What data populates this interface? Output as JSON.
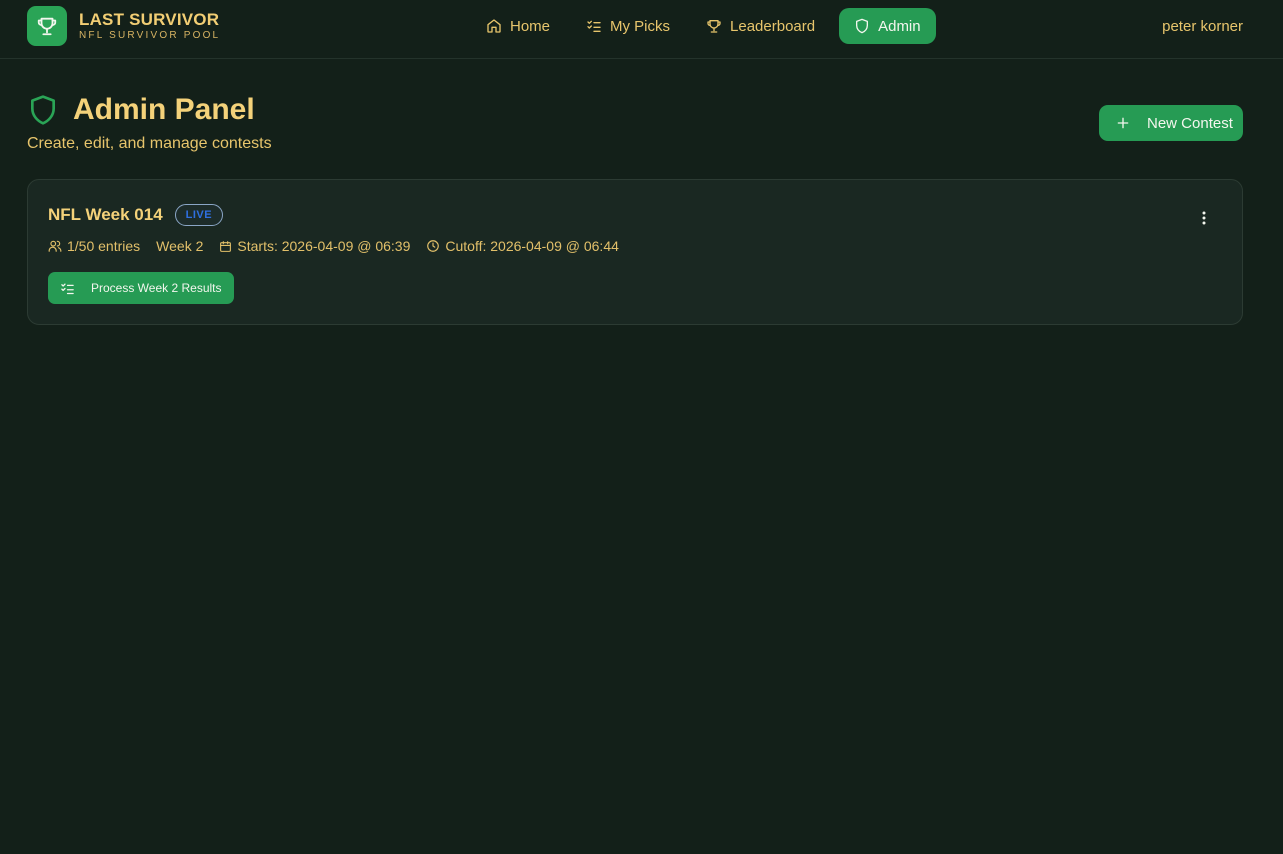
{
  "brand": {
    "title": "LAST SURVIVOR",
    "subtitle": "NFL SURVIVOR POOL",
    "logo_icon": "trophy-icon"
  },
  "nav": {
    "items": [
      {
        "label": "Home",
        "icon": "home-icon"
      },
      {
        "label": "My Picks",
        "icon": "checklist-icon"
      },
      {
        "label": "Leaderboard",
        "icon": "trophy-icon"
      },
      {
        "label": "Admin",
        "icon": "shield-icon",
        "active": true
      }
    ]
  },
  "user": {
    "name": "peter korner"
  },
  "page": {
    "title": "Admin Panel",
    "subtitle": "Create, edit, and manage contests",
    "title_icon": "shield-icon",
    "new_contest_label": "New Contest"
  },
  "contests": [
    {
      "title": "NFL Week 014",
      "status": "LIVE",
      "entries": "1/50 entries",
      "week": "Week 2",
      "starts": "Starts: 2026-04-09 @ 06:39",
      "cutoff": "Cutoff: 2026-04-09 @ 06:44",
      "process_label": "Process Week 2 Results"
    }
  ],
  "colors": {
    "background": "#132019",
    "accent": "#269b54",
    "text_gold": "#f4d27a",
    "live_badge": "#2f6fe0"
  }
}
